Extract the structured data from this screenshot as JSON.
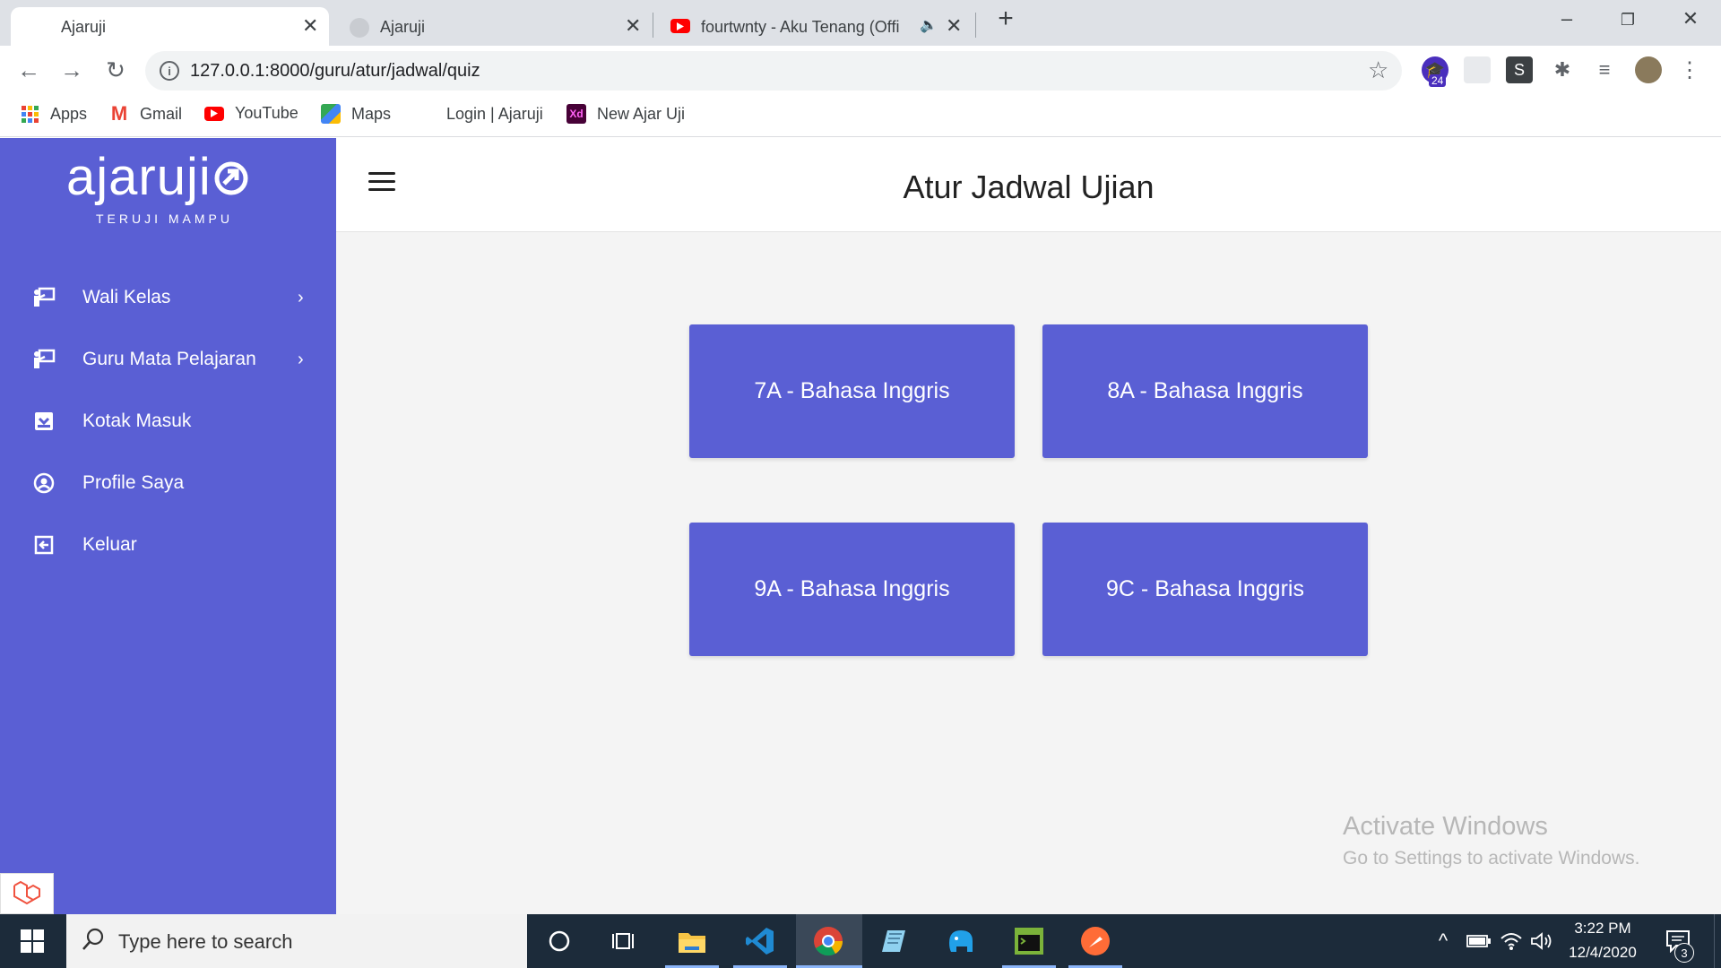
{
  "browser": {
    "tabs": [
      {
        "title": "Ajaruji",
        "active": true
      },
      {
        "title": "Ajaruji",
        "active": false
      },
      {
        "title": "fourtwnty - Aku Tenang (Offi",
        "active": false
      }
    ],
    "url": "127.0.0.1:8000/guru/atur/jadwal/quiz",
    "extension_badge": "24",
    "extension_s": "S",
    "bookmarks": [
      {
        "label": "Apps",
        "icon": "apps-grid-icon"
      },
      {
        "label": "Gmail",
        "icon": "gmail-icon"
      },
      {
        "label": "YouTube",
        "icon": "youtube-icon"
      },
      {
        "label": "Maps",
        "icon": "maps-icon"
      },
      {
        "label": "Login | Ajaruji",
        "icon": "ajaruji-icon"
      },
      {
        "label": "New Ajar Uji",
        "icon": "xd-icon",
        "icon_text": "Xd"
      }
    ]
  },
  "sidebar": {
    "logo": "ajaruji",
    "tagline": "TERUJI MAMPU",
    "items": [
      {
        "label": "Wali Kelas",
        "has_submenu": true
      },
      {
        "label": "Guru Mata Pelajaran",
        "has_submenu": true
      },
      {
        "label": "Kotak Masuk",
        "has_submenu": false
      },
      {
        "label": "Profile Saya",
        "has_submenu": false
      },
      {
        "label": "Keluar",
        "has_submenu": false
      }
    ]
  },
  "main": {
    "title": "Atur Jadwal Ujian",
    "cards": [
      {
        "label": "7A - Bahasa Inggris"
      },
      {
        "label": "8A - Bahasa Inggris"
      },
      {
        "label": "9A - Bahasa Inggris"
      },
      {
        "label": "9C - Bahasa Inggris"
      }
    ]
  },
  "watermark": {
    "line1": "Activate Windows",
    "line2": "Go to Settings to activate Windows."
  },
  "taskbar": {
    "search_placeholder": "Type here to search",
    "time": "3:22 PM",
    "date": "12/4/2020",
    "notification_count": "3"
  },
  "colors": {
    "accent": "#5a5fd4",
    "main_bg": "#f4f4f4"
  }
}
